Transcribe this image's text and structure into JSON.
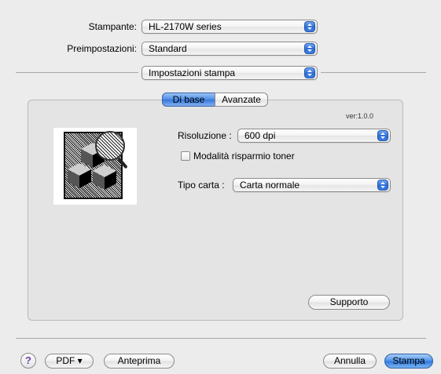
{
  "printer": {
    "label": "Stampante:",
    "value": "HL-2170W series"
  },
  "presets": {
    "label": "Preimpostazioni:",
    "value": "Standard"
  },
  "panel_select": {
    "value": "Impostazioni stampa"
  },
  "tabs": [
    {
      "label": "Di base",
      "active": true
    },
    {
      "label": "Avanzate",
      "active": false
    }
  ],
  "version": "ver:1.0.0",
  "resolution": {
    "label": "Risoluzione :",
    "value": "600 dpi"
  },
  "toner_save": {
    "label": "Modalità risparmio toner",
    "checked": false
  },
  "paper_type": {
    "label": "Tipo carta :",
    "value": "Carta normale"
  },
  "support_button": "Supporto",
  "footer": {
    "help_label": "?",
    "pdf_button": "PDF ▾",
    "preview_button": "Anteprima",
    "cancel_button": "Annulla",
    "print_button": "Stampa"
  },
  "colors": {
    "accent": "#3576da",
    "window_bg": "#ececec"
  }
}
